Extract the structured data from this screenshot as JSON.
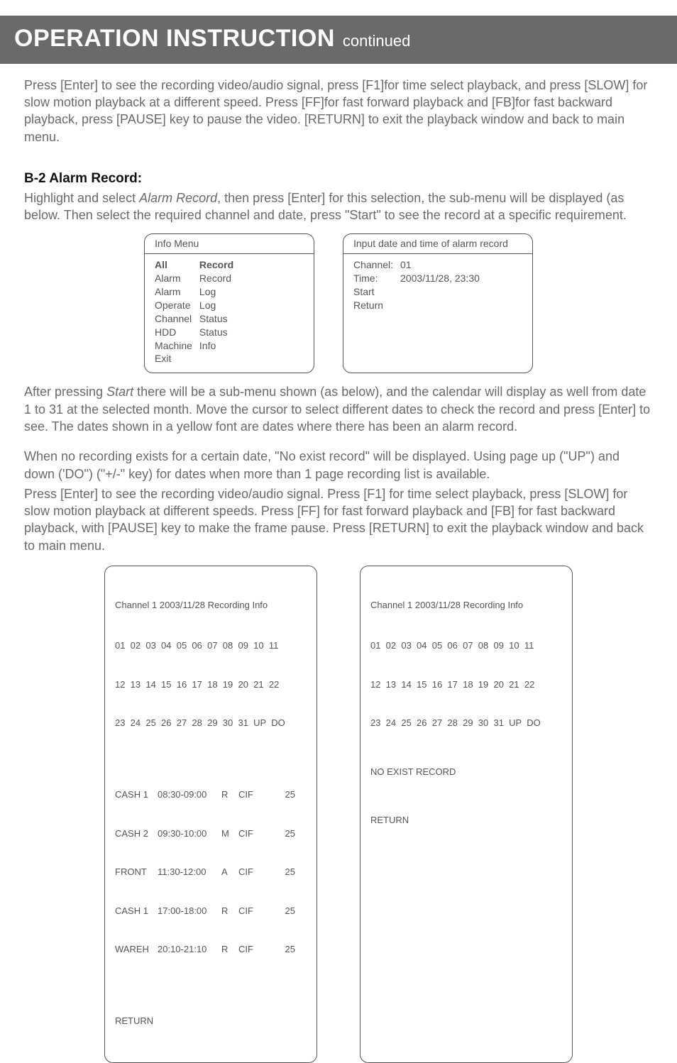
{
  "header": {
    "title": "OPERATION INSTRUCTION",
    "subtitle": "continued"
  },
  "para1a": "Press [Enter] to see the recording video/audio signal, press [F1]for time select playback, and press [SLOW] for slow motion playback at a different speed. Press [FF]for fast forward playback and [FB]for fast backward playback, press [PAUSE] key to pause the video. [RETURN] to exit the playback window and back to main menu.",
  "section_heading": "B-2  Alarm Record:",
  "para2a": "Highlight and select ",
  "para2_italic": "Alarm Record",
  "para2b": ", then press [Enter] for this selection, the sub-menu will be displayed (as below. Then select the required channel and date, press \"Start\" to see the record at a specific requirement.",
  "info_menu": {
    "title": "Info Menu",
    "left": [
      "All",
      "Alarm",
      "Alarm",
      "Operate",
      "Channel",
      "HDD",
      "Machine",
      "Exit"
    ],
    "right": [
      "Record",
      "Record",
      "Log",
      "Log",
      "Status",
      "Status",
      "Info",
      ""
    ]
  },
  "input_box": {
    "title": "Input date and time of alarm record",
    "labels": [
      "Channel:",
      "Time:",
      "Start",
      "Return"
    ],
    "values": [
      "01",
      "2003/11/28, 23:30",
      "",
      ""
    ]
  },
  "para3a": "After pressing ",
  "para3_italic": "Start",
  "para3b": " there will be a sub-menu shown (as below), and the calendar will display as well from date 1 to 31 at the selected month. Move the cursor to select different dates to check the record and press [Enter] to see. The dates shown in a yellow font are dates where there has been an alarm record.",
  "para4": "When no recording exists for a certain date, \"No exist record\" will be displayed. Using page up (\"UP\") and down ('DO\") (\"+/-\" key) for dates when more than 1 page recording list is available.",
  "para5": "Press [Enter] to see the recording video/audio signal. Press [F1] for time select playback, press [SLOW] for slow motion playback at different speeds. Press [FF] for fast forward playback and [FB] for fast backward playback, with [PAUSE] key to make the frame pause. Press [RETURN] to exit the playback window and back to main menu.",
  "cal_box1": {
    "title": "Channel 1 2003/11/28 Recording Info",
    "row1": "01  02  03  04  05  06  07  08  09  10  11",
    "row2": "12  13  14  15  16  17  18  19  20  21  22",
    "row3": "23  24  25  26  27  28  29  30  31  UP  DO",
    "records": [
      {
        "loc": "CASH 1",
        "time": "08:30-09:00",
        "m": "R",
        "fmt": "CIF",
        "size": "25"
      },
      {
        "loc": "CASH 2",
        "time": "09:30-10:00",
        "m": "M",
        "fmt": "CIF",
        "size": "25"
      },
      {
        "loc": "FRONT",
        "time": "11:30-12:00",
        "m": "A",
        "fmt": "CIF",
        "size": "25"
      },
      {
        "loc": "CASH 1",
        "time": "17:00-18:00",
        "m": "R",
        "fmt": "CIF",
        "size": "25"
      },
      {
        "loc": "WAREH",
        "time": "20:10-21:10",
        "m": "R",
        "fmt": "CIF",
        "size": "25"
      }
    ],
    "return": "RETURN"
  },
  "cal_box2": {
    "title": "Channel 1 2003/11/28 Recording Info",
    "row1": "01  02  03  04  05  06  07  08  09  10  11",
    "row2": "12  13  14  15  16  17  18  19  20  21  22",
    "row3": "23  24  25  26  27  28  29  30  31  UP  DO",
    "noexist": "NO EXIST RECORD",
    "return": "RETURN"
  }
}
